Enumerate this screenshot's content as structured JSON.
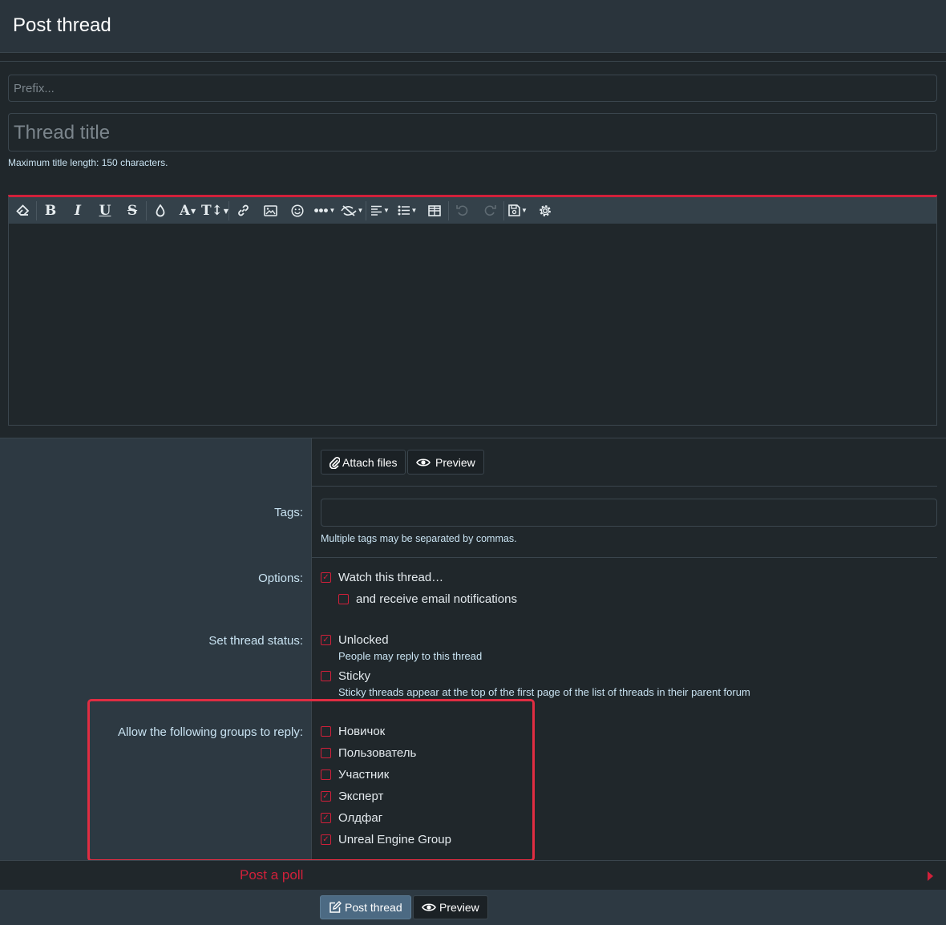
{
  "header": {
    "title": "Post thread"
  },
  "form": {
    "prefix_placeholder": "Prefix...",
    "title_placeholder": "Thread title",
    "title_hint": "Maximum title length: 150 characters."
  },
  "editor": {
    "toolbar_icons": [
      "eraser-icon",
      "bold-icon",
      "italic-icon",
      "underline-icon",
      "strikethrough-icon",
      "color-icon",
      "font-icon",
      "text-size-icon",
      "link-icon",
      "image-icon",
      "smile-icon",
      "more-icon",
      "spoiler-icon",
      "align-icon",
      "list-icon",
      "table-icon",
      "undo-icon",
      "redo-icon",
      "drafts-icon",
      "settings-icon"
    ]
  },
  "actions": {
    "attach_files": "Attach files",
    "preview": "Preview"
  },
  "tags": {
    "label": "Tags:",
    "hint": "Multiple tags may be separated by commas."
  },
  "options": {
    "label": "Options:",
    "watch": "Watch this thread…",
    "email": "and receive email notifications"
  },
  "status": {
    "label": "Set thread status:",
    "unlocked": "Unlocked",
    "unlocked_hint": "People may reply to this thread",
    "sticky": "Sticky",
    "sticky_hint": "Sticky threads appear at the top of the first page of the list of threads in their parent forum"
  },
  "groups": {
    "label": "Allow the following groups to reply:",
    "items": [
      {
        "name": "Новичок",
        "checked": false
      },
      {
        "name": "Пользователь",
        "checked": false
      },
      {
        "name": "Участник",
        "checked": false
      },
      {
        "name": "Эксперт",
        "checked": true
      },
      {
        "name": "Олдфаг",
        "checked": true
      },
      {
        "name": "Unreal Engine Group",
        "checked": true
      }
    ]
  },
  "poll": {
    "label": "Post a poll"
  },
  "footer": {
    "post_thread": "Post thread",
    "preview": "Preview"
  },
  "colors": {
    "accent": "#d1203a",
    "highlight": "#e02d42"
  }
}
